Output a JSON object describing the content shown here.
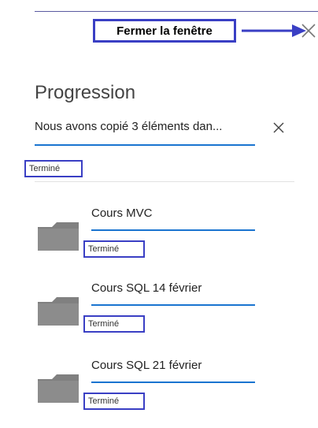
{
  "annotations": {
    "close_window_label": "Fermer la fenêtre"
  },
  "panel": {
    "title": "Progression",
    "status_message": "Nous avons copié 3 éléments dan...",
    "status": "Terminé"
  },
  "items": [
    {
      "name": "Cours MVC",
      "status": "Terminé"
    },
    {
      "name": "Cours SQL 14 février",
      "status": "Terminé"
    },
    {
      "name": "Cours SQL 21 février",
      "status": "Terminé"
    }
  ],
  "colors": {
    "accent_blue": "#1a74d0",
    "annotation_blue": "#3a3fc4",
    "folder_gray": "#808080"
  },
  "icons": {
    "close": "close-icon",
    "dismiss": "dismiss-icon",
    "folder": "folder-icon",
    "arrow": "arrow-right-icon"
  }
}
